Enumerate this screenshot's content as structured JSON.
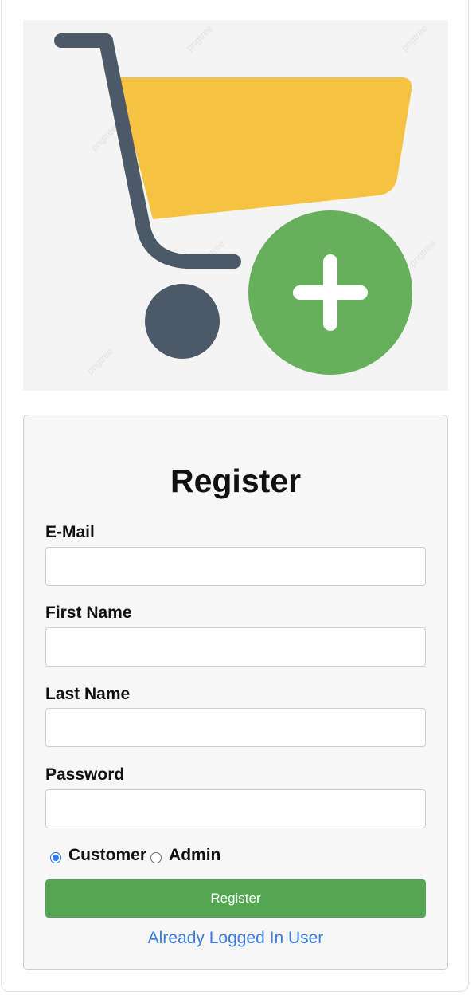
{
  "hero": {
    "image_icon": "shopping-cart-add-icon",
    "watermark": "pngtree",
    "colors": {
      "background": "#f4f4f4",
      "cart_frame": "#4b5a66",
      "cart_basket": "#f5c341",
      "plus_circle": "#66b05c",
      "plus_sign": "#ffffff"
    }
  },
  "form": {
    "title": "Register",
    "fields": [
      {
        "label": "E-Mail",
        "value": "",
        "placeholder": ""
      },
      {
        "label": "First Name",
        "value": "",
        "placeholder": ""
      },
      {
        "label": "Last Name",
        "value": "",
        "placeholder": ""
      },
      {
        "label": "Password",
        "value": "",
        "placeholder": ""
      }
    ],
    "roles": [
      {
        "label": "Customer",
        "checked": true
      },
      {
        "label": "Admin",
        "checked": false
      }
    ],
    "submit_label": "Register",
    "login_link": "Already Logged In User"
  },
  "colors": {
    "accent_green": "#54a653",
    "link_blue": "#3a7be0",
    "radio_blue": "#2f7bf6"
  }
}
